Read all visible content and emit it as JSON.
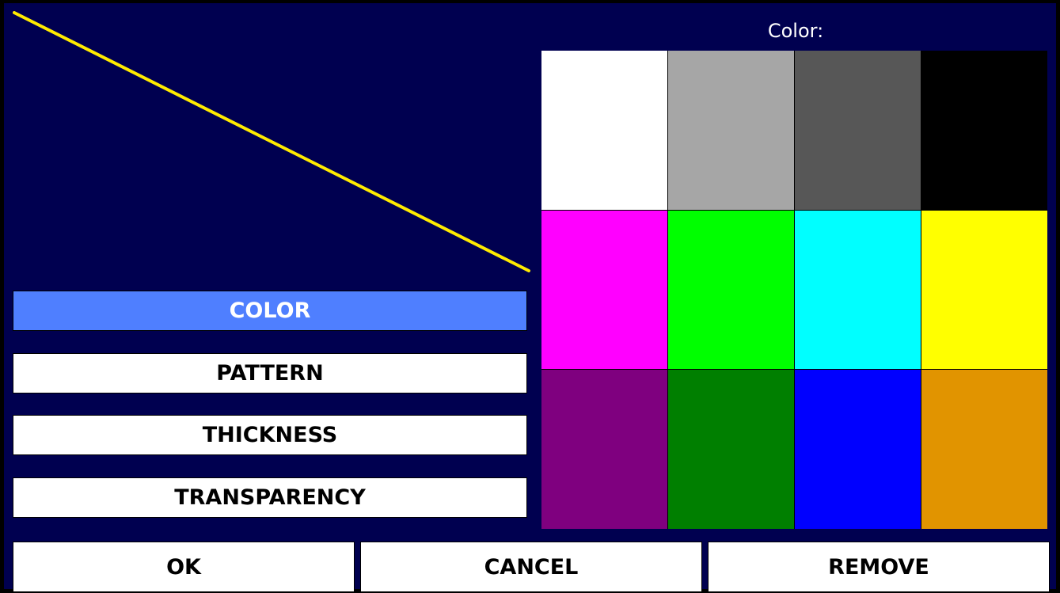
{
  "preview": {
    "line_color": "#ffeb00"
  },
  "tabs": [
    {
      "label": "COLOR",
      "active": true
    },
    {
      "label": "PATTERN",
      "active": false
    },
    {
      "label": "THICKNESS",
      "active": false
    },
    {
      "label": "TRANSPARENCY",
      "active": false
    }
  ],
  "color_panel": {
    "title": "Color:",
    "swatches": [
      {
        "name": "white",
        "hex": "#ffffff"
      },
      {
        "name": "light-gray",
        "hex": "#a6a6a6"
      },
      {
        "name": "dark-gray",
        "hex": "#575757"
      },
      {
        "name": "black",
        "hex": "#000000"
      },
      {
        "name": "magenta",
        "hex": "#ff00ff"
      },
      {
        "name": "green",
        "hex": "#00ff00"
      },
      {
        "name": "cyan",
        "hex": "#00ffff"
      },
      {
        "name": "yellow",
        "hex": "#ffff00"
      },
      {
        "name": "purple",
        "hex": "#7f007f"
      },
      {
        "name": "dark-green",
        "hex": "#007f00"
      },
      {
        "name": "blue",
        "hex": "#0000ff"
      },
      {
        "name": "orange",
        "hex": "#e19400"
      }
    ]
  },
  "buttons": {
    "ok": "OK",
    "cancel": "CANCEL",
    "remove": "REMOVE"
  },
  "colors": {
    "background": "#000050",
    "active_tab": "#4f7fff"
  }
}
